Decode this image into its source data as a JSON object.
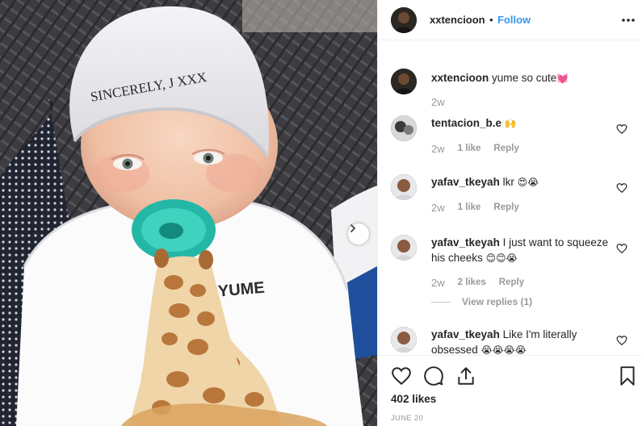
{
  "post": {
    "username": "xxtencioon",
    "separator": "•",
    "follow_label": "Follow",
    "more_icon": "more-horizontal-icon"
  },
  "photo": {
    "hat_text": "SINCERELY, J XXX",
    "shirt_text": "YUME",
    "next_icon": "chevron-right-icon"
  },
  "comments": [
    {
      "username": "xxtencioon",
      "text": "yume so cute",
      "trailing": "💓",
      "time": "2w",
      "likes": "",
      "reply": ""
    },
    {
      "username": "tentacion_b.e",
      "text": "",
      "trailing": "🙌",
      "time": "2w",
      "likes": "1 like",
      "reply": "Reply"
    },
    {
      "username": "yafav_tkeyah",
      "text": "lkr",
      "trailing": "😍😭",
      "time": "2w",
      "likes": "1 like",
      "reply": "Reply"
    },
    {
      "username": "yafav_tkeyah",
      "text": "I just want to squeeze his cheeks",
      "trailing": "😊😊😭",
      "time": "2w",
      "likes": "2 likes",
      "reply": "Reply",
      "view_replies": "View replies (1)"
    },
    {
      "username": "yafav_tkeyah",
      "text": "Like I'm literally obsessed",
      "trailing": "😭😭😭😭",
      "time": "",
      "likes": "",
      "reply": ""
    }
  ],
  "actions": {
    "like_icon": "heart-icon",
    "comment_icon": "comment-icon",
    "share_icon": "share-icon",
    "save_icon": "bookmark-icon",
    "likes_count": "402 likes",
    "date": "JUNE 20"
  },
  "colors": {
    "link_blue": "#3897f0",
    "muted_gray": "#999999",
    "border": "#efefef",
    "pacifier": "#2ec4b0"
  }
}
